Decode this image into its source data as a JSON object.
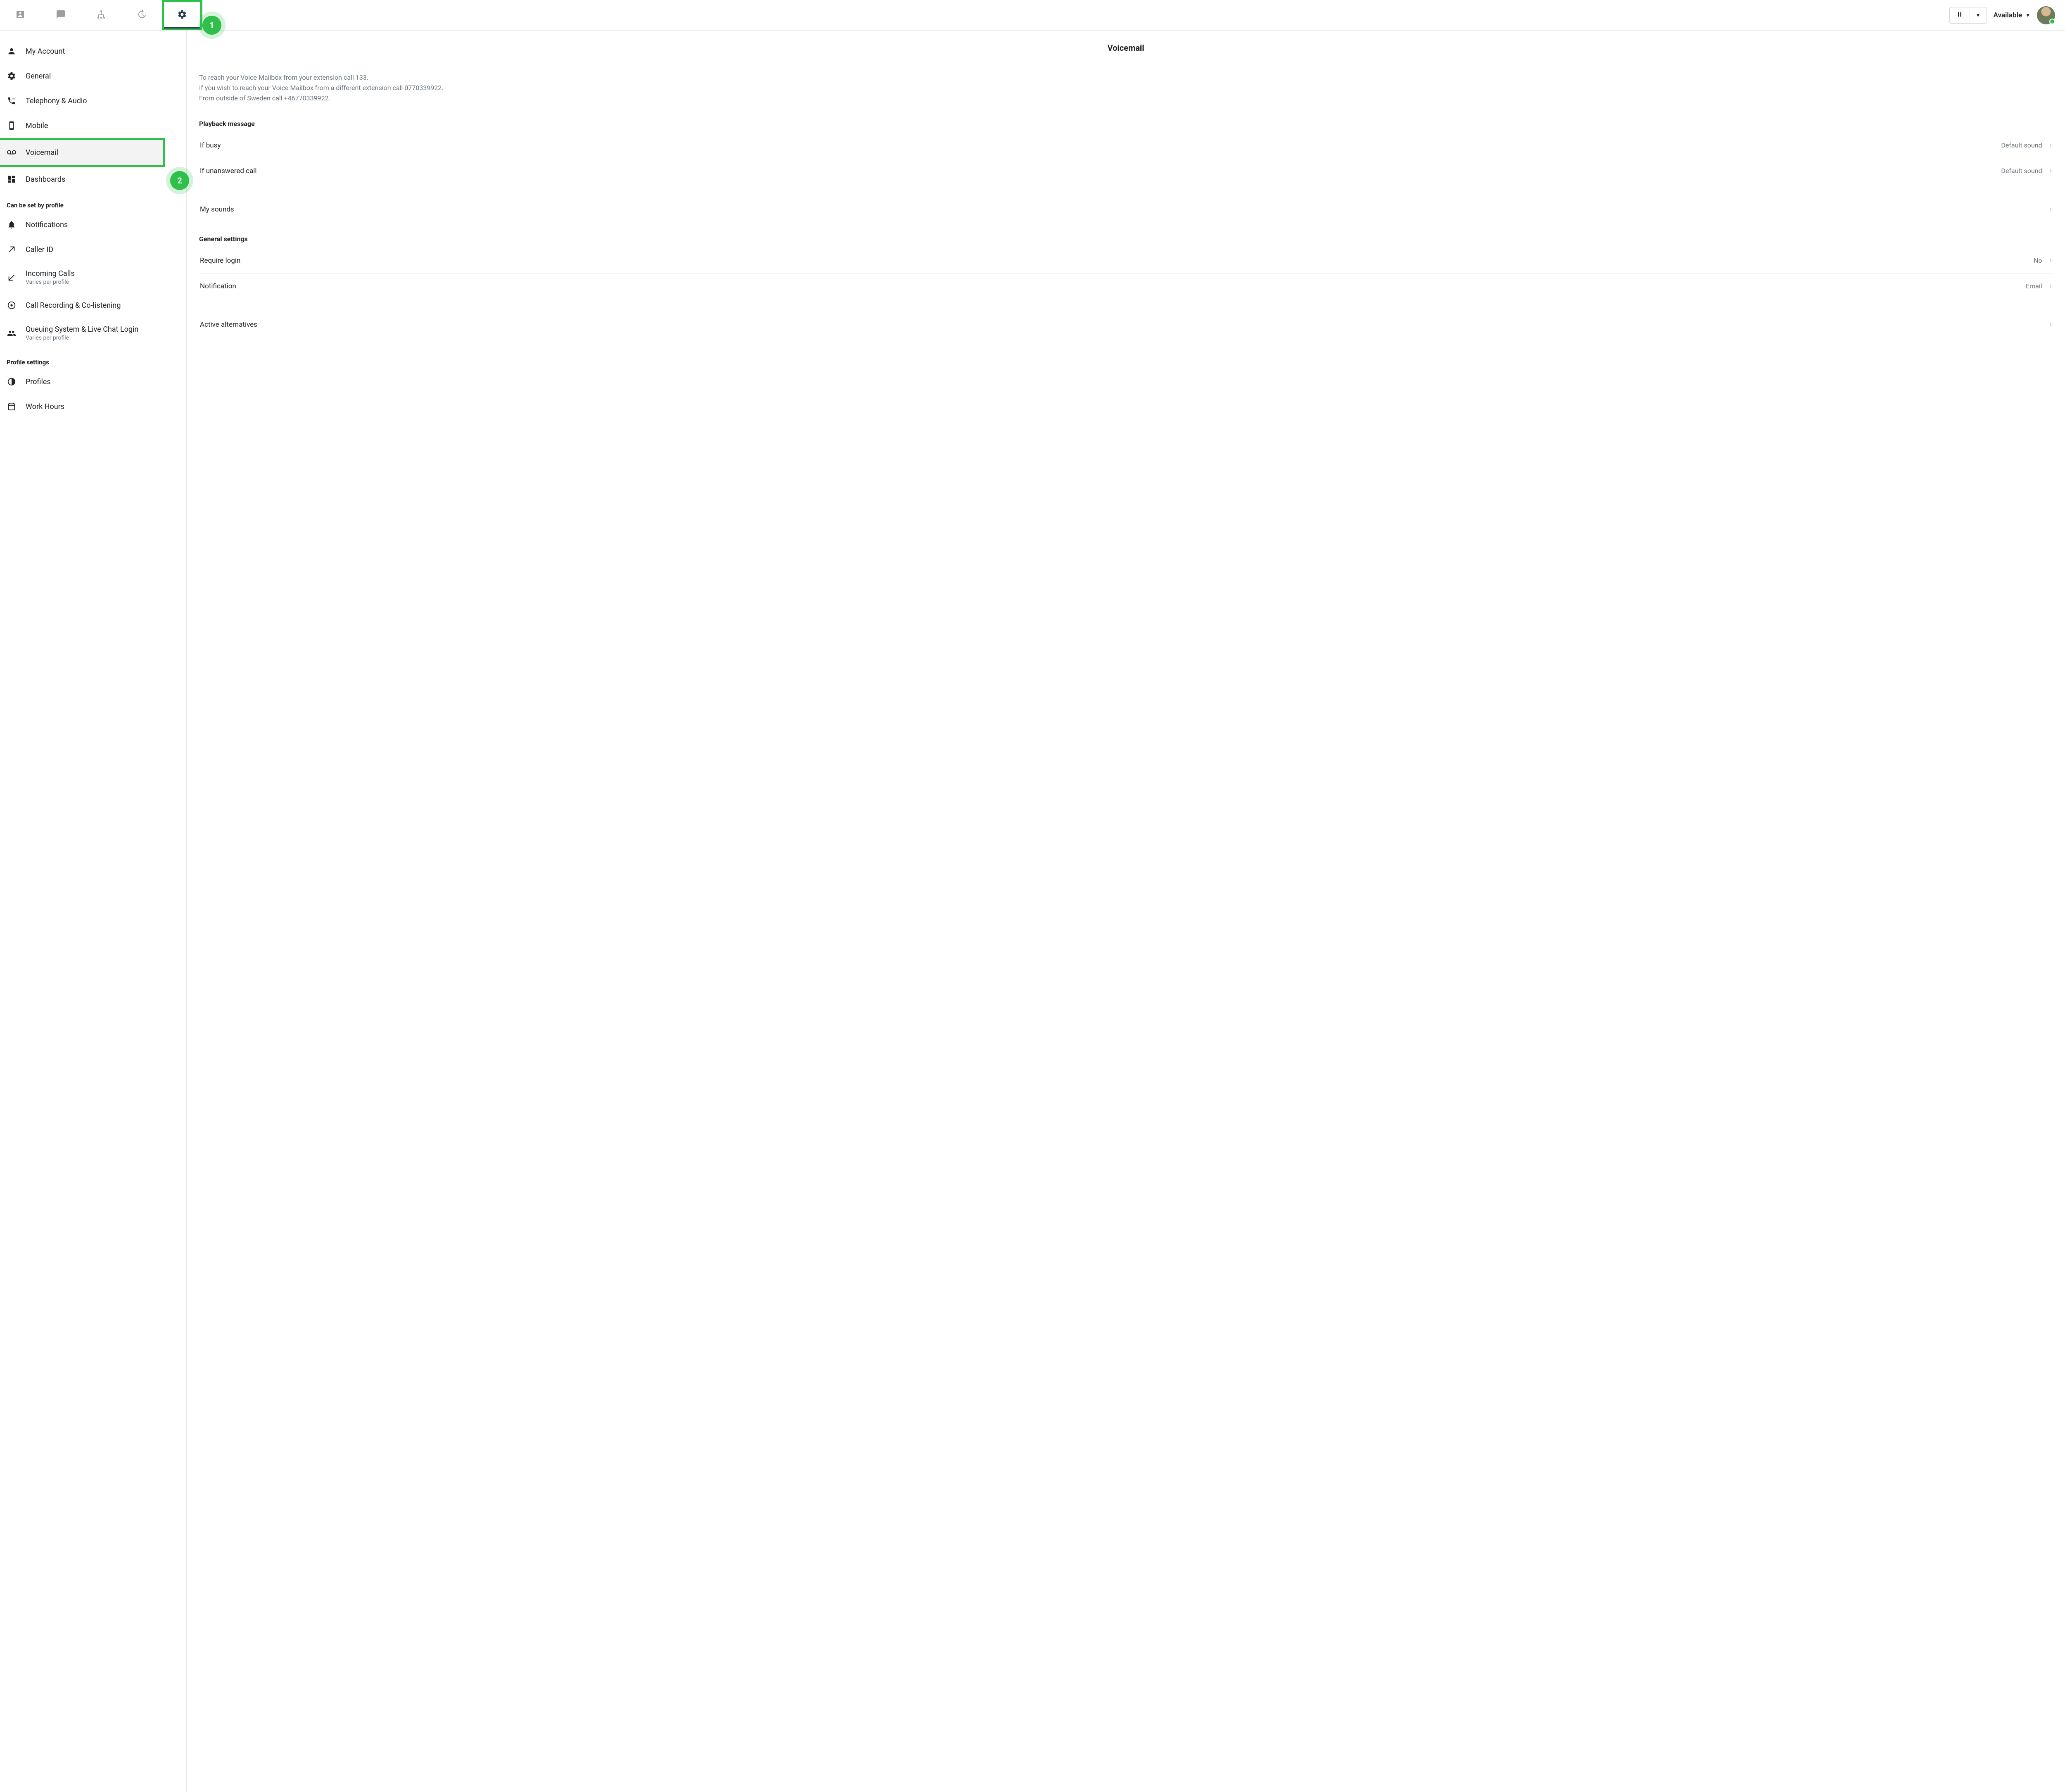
{
  "header": {
    "tabs": [
      {
        "name": "contacts-tab"
      },
      {
        "name": "chat-tab"
      },
      {
        "name": "org-tab"
      },
      {
        "name": "history-tab"
      },
      {
        "name": "settings-tab"
      }
    ],
    "status_label": "Available"
  },
  "callouts": {
    "one": "1",
    "two": "2"
  },
  "sidebar": {
    "items_primary": [
      {
        "label": "My Account",
        "icon": "person-icon"
      },
      {
        "label": "General",
        "icon": "gear-icon"
      },
      {
        "label": "Telephony & Audio",
        "icon": "phone-settings-icon"
      },
      {
        "label": "Mobile",
        "icon": "mobile-icon"
      },
      {
        "label": "Voicemail",
        "icon": "voicemail-icon"
      },
      {
        "label": "Dashboards",
        "icon": "dashboard-icon"
      }
    ],
    "section_profile_header": "Can be set by profile",
    "items_profile": [
      {
        "label": "Notifications",
        "icon": "bell-icon"
      },
      {
        "label": "Caller ID",
        "icon": "arrow-outgoing-icon"
      },
      {
        "label": "Incoming Calls",
        "sub": "Varies per profile",
        "icon": "arrow-incoming-icon"
      },
      {
        "label": "Call Recording & Co-listening",
        "icon": "record-icon"
      },
      {
        "label": "Queuing System & Live Chat Login",
        "sub": "Varies per profile",
        "icon": "people-icon"
      }
    ],
    "section_settings_header": "Profile settings",
    "items_settings": [
      {
        "label": "Profiles",
        "icon": "half-circle-icon"
      },
      {
        "label": "Work Hours",
        "icon": "calendar-icon"
      }
    ]
  },
  "main": {
    "title": "Voicemail",
    "instructions": {
      "line1": "To reach your Voice Mailbox from your extension call 133.",
      "line2": "If you wish to reach your Voice Mailbox from a different extension call 0770339922.",
      "line3": "From outside of Sweden call +46770339922."
    },
    "playback_heading": "Playback message",
    "playback_rows": [
      {
        "label": "If busy",
        "value": "Default sound"
      },
      {
        "label": "If unanswered call",
        "value": "Default sound"
      }
    ],
    "my_sounds_label": "My sounds",
    "general_heading": "General settings",
    "general_rows": [
      {
        "label": "Require login",
        "value": "No"
      },
      {
        "label": "Notification",
        "value": "Email"
      }
    ],
    "active_alternatives_label": "Active alternatives"
  }
}
